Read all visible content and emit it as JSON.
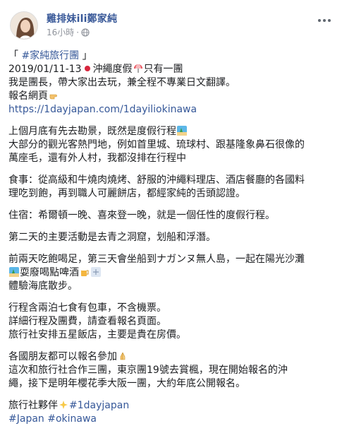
{
  "post": {
    "author": "雞排妹ili鄭家純",
    "time": "16小時",
    "sep": "·"
  },
  "content": {
    "l1_open": "「 ",
    "l1_tag": "#家純旅行團",
    "l1_close": " 」",
    "l2_a": "2019/01/11-13",
    "l2_b": "沖繩度假",
    "l2_c": "只有一團",
    "l3": "我是團長，帶大家出去玩，兼全程不專業日文翻譯。",
    "l4": "報名網頁",
    "l5_link": "https://1dayjapan.com/1dayiliokinawa",
    "p2_l1": "上個月底有先去勘景，既然是度假行程",
    "p2_l2": "大部分的觀光客熱門地，例如首里城、琉球村、跟基隆象鼻石很像的",
    "p2_l3": "萬座毛，還有外人村，我都沒排在行程中",
    "p3_l1": "食事：從高級和牛燒肉燒烤、舒服的沖繩料理店、酒店餐廳的各國料",
    "p3_l2": "理吃到飽，再到職人可麗餅店，都經家純的舌頭認證。",
    "p4_l1": "住宿：希爾頓一晚、喜來登一晚，就是一個任性的度假行程。",
    "p5_l1": "第二天的主要活動是去青之洞窟，划船和浮潛。",
    "p6_l1": "前兩天吃飽喝足，第三天會坐船到ナガンヌ無人島，一起在陽光沙灘",
    "p6_l2": "耍廢喝點啤酒",
    "p6_l3": "體驗海底散步。",
    "p7_l1": "行程含兩泊七食有包車，不含機票。",
    "p7_l2": "詳細行程及團費，請查看報名頁面。",
    "p7_l3": "旅行社安排五星飯店，主要是貴在房價。",
    "p8_l1": "各國朋友都可以報名參加",
    "p8_l2": "這次和旅行社合作三團，東京團19號去賞楓，現在開始報名的沖",
    "p8_l3": "繩，接下是明年櫻花季大阪一團，大約年底公開報名。",
    "p9_l1": "旅行社夥伴",
    "p9_tag1": "#1dayjapan",
    "p9_tag2": "#Japan",
    "p9_tag3": "#okinawa"
  },
  "colors": {
    "link": "#365899",
    "author": "#385898",
    "meta": "#90949c",
    "text": "#1c1e21"
  },
  "icons": [
    "globe-icon",
    "more-icon",
    "japan-flag-icon",
    "umbrella-icon",
    "pointing-finger-icon",
    "beach-icon",
    "beach-icon-2",
    "beer-icon",
    "dizzy-icon",
    "pray-hands-icon",
    "sparkle-icon"
  ]
}
